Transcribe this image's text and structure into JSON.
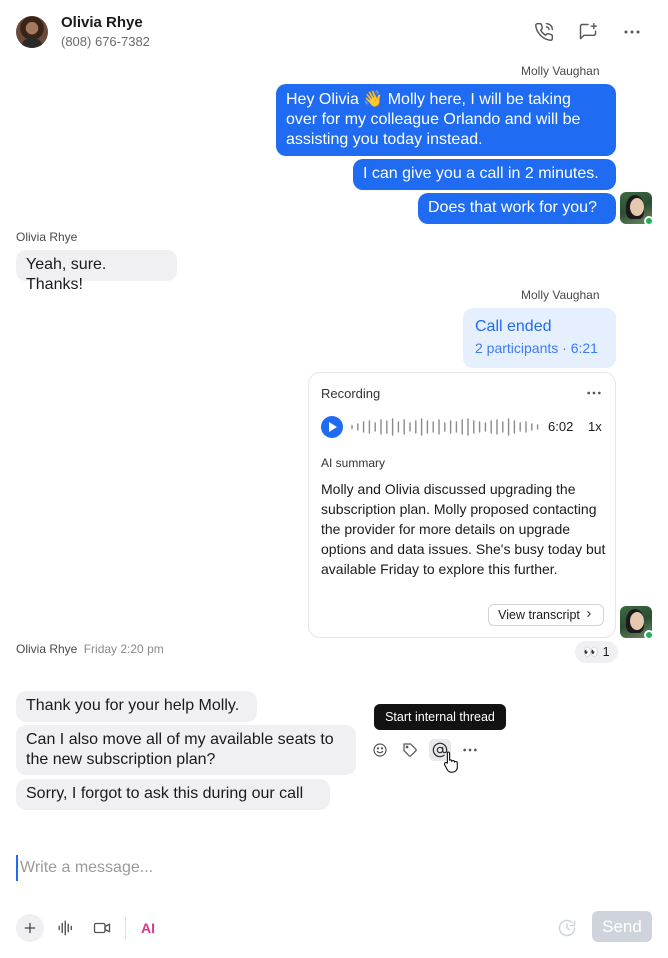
{
  "header": {
    "contact_name": "Olivia Rhye",
    "contact_phone": "(808) 676-7382",
    "icons": [
      "phone-call-icon",
      "message-plus-icon",
      "more-horizontal-icon"
    ]
  },
  "messages": {
    "outgoing_sender_1": "Molly Vaughan",
    "out_1": "Hey Olivia 👋 Molly here, I will be taking over for my colleague Orlando and will be assisting you today instead.",
    "out_2": "I can give you a call in 2 minutes.",
    "out_3": "Does that work for you?",
    "incoming_sender_1": "Olivia Rhye",
    "in_1": "Yeah, sure. Thanks!",
    "outgoing_sender_2": "Molly Vaughan",
    "call_title": "Call ended",
    "call_sub": "2 participants · 6:21",
    "recording": {
      "label": "Recording",
      "duration": "6:02",
      "speed": "1x",
      "ai_label": "AI summary",
      "ai_text": "Molly and Olivia discussed upgrading the subscription plan. Molly proposed contacting the provider for more details on upgrade options and data issues. She's busy today but available Friday to explore this further.",
      "transcript_label": "View transcript"
    },
    "reaction_emoji": "👀",
    "reaction_count": "1",
    "incoming_sender_2": "Olivia Rhye",
    "incoming_time_2": "Friday 2:20 pm",
    "in_2": "Thank you for your help Molly.",
    "in_3": "Can I also move all of my available seats to the new subscription plan?",
    "in_4": "Sorry, I forgot to ask this during our call"
  },
  "hover_toolbar": {
    "tooltip": "Start internal thread",
    "icons": [
      "emoji-icon",
      "tag-icon",
      "at-sign-icon",
      "more-horizontal-icon"
    ]
  },
  "composer": {
    "placeholder": "Write a message...",
    "ai_label": "AI",
    "send_label": "Send"
  },
  "colors": {
    "accent": "#1f6bf2",
    "incoming_bubble": "#f0f0f2",
    "call_card": "#e5effd",
    "online": "#1fb15c",
    "ai": "#e0368a"
  }
}
